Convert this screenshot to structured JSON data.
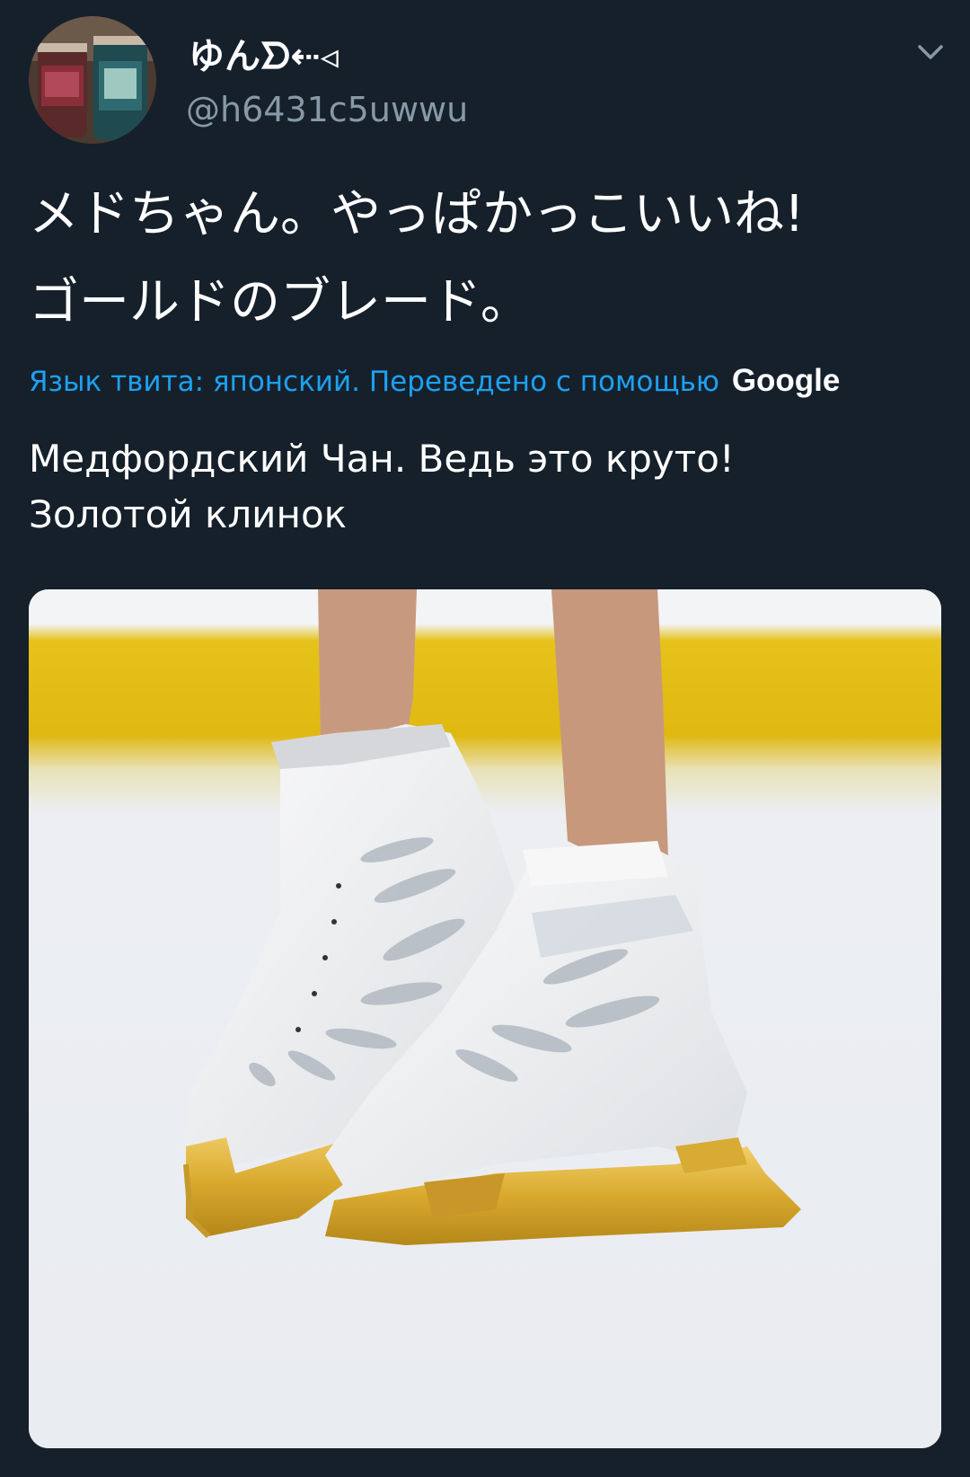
{
  "tweet": {
    "author": {
      "display_name": "ゆんᗤ⇠◃",
      "handle": "@h6431c5uwwu",
      "avatar_icon": "avatar-photo"
    },
    "menu_icon": "chevron-down-icon",
    "text_lines": [
      "メドちゃん。やっぱかっこいいね!",
      "ゴールドのブレード。"
    ],
    "translation": {
      "notice": "Язык твита: японский. Переведено с помощью",
      "provider": "Google",
      "text_lines": [
        "Медфордский Чан. Ведь это круто!",
        "Золотой клинок"
      ]
    },
    "media": {
      "icon": "figure-skates-photo"
    }
  },
  "colors": {
    "background": "#15202b",
    "text": "#ffffff",
    "secondary": "#8899a6",
    "link": "#1da1f2"
  }
}
